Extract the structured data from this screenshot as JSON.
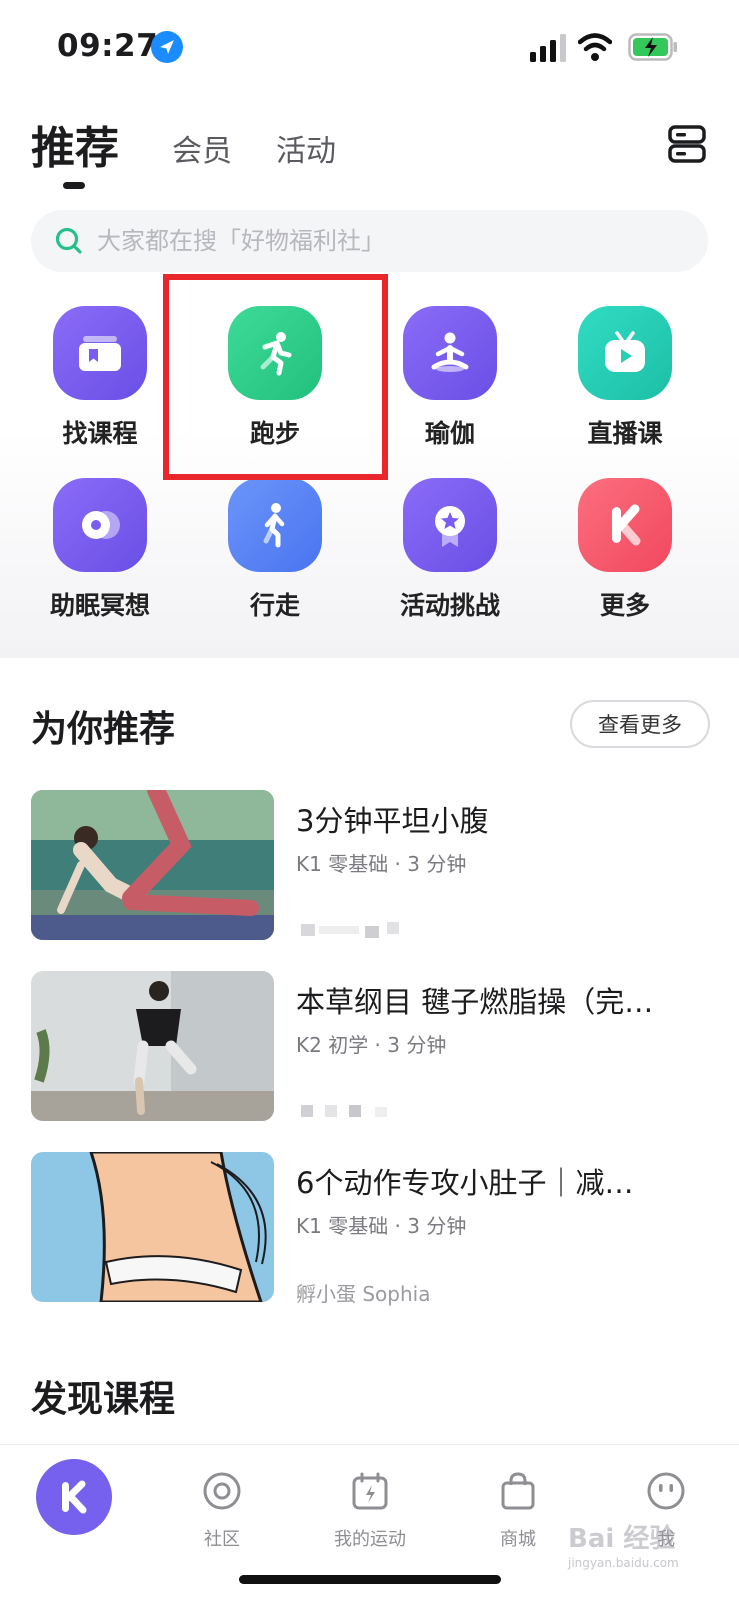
{
  "status_bar": {
    "time": "09:27"
  },
  "header": {
    "tabs": [
      {
        "label": "推荐",
        "active": true
      },
      {
        "label": "会员"
      },
      {
        "label": "活动"
      }
    ]
  },
  "search": {
    "placeholder": "大家都在搜「好物福利社」"
  },
  "categories": [
    {
      "label": "找课程",
      "icon": "course-icon",
      "color": "#7a5cf0"
    },
    {
      "label": "跑步",
      "icon": "running-icon",
      "color": "#2fcf8a",
      "highlighted": true
    },
    {
      "label": "瑜伽",
      "icon": "yoga-icon",
      "color": "#7a5cf0"
    },
    {
      "label": "直播课",
      "icon": "live-tv-icon",
      "color": "#25d0b6"
    },
    {
      "label": "助眠冥想",
      "icon": "meditation-icon",
      "color": "#7a5cf0"
    },
    {
      "label": "行走",
      "icon": "walking-icon",
      "color": "#5b86f7"
    },
    {
      "label": "活动挑战",
      "icon": "badge-icon",
      "color": "#7a5cf0"
    },
    {
      "label": "更多",
      "icon": "keep-k-icon",
      "color": "#f75a6e"
    }
  ],
  "recommend": {
    "title": "为你推荐",
    "more_label": "查看更多",
    "courses": [
      {
        "title": "3分钟平坦小腹",
        "meta": "K1 零基础 · 3 分钟",
        "author": ""
      },
      {
        "title": "本草纲目 毽子燃脂操（完…",
        "meta": "K2 初学 · 3 分钟",
        "author": ""
      },
      {
        "title": "6个动作专攻小肚子｜减…",
        "meta": "K1 零基础 · 3 分钟",
        "author": "孵小蛋 Sophia"
      }
    ]
  },
  "discover": {
    "title": "发现课程"
  },
  "tabbar": {
    "items": [
      {
        "label": "",
        "icon": "keep-k-icon"
      },
      {
        "label": "社区",
        "icon": "community-icon"
      },
      {
        "label": "我的运动",
        "icon": "my-sport-icon"
      },
      {
        "label": "商城",
        "icon": "shop-bag-icon"
      },
      {
        "label": "我",
        "icon": "profile-icon"
      }
    ]
  },
  "watermark": {
    "text": "Bai 经验",
    "sub": "jingyan.baidu.com"
  },
  "colors": {
    "highlight_border": "#e8262b",
    "brand_purple": "#7561ee"
  }
}
